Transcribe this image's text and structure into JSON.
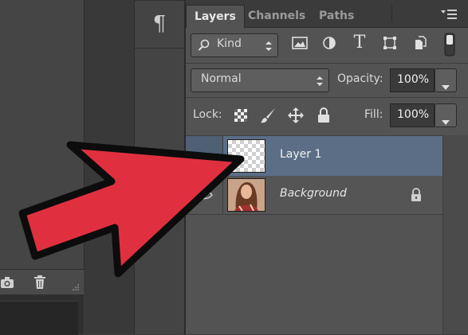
{
  "panel": {
    "tabs": [
      {
        "label": "Layers",
        "active": true
      },
      {
        "label": "Channels",
        "active": false
      },
      {
        "label": "Paths",
        "active": false
      }
    ],
    "filter": {
      "label": "Kind"
    },
    "blend_mode": "Normal",
    "opacity_label": "Opacity:",
    "opacity_value": "100%",
    "lock_label": "Lock:",
    "fill_label": "Fill:",
    "fill_value": "100%"
  },
  "layers": [
    {
      "name": "Layer 1",
      "selected": true
    },
    {
      "name": "Background",
      "italic": true,
      "locked": true
    }
  ],
  "left_toolbar": {
    "paragraph_icon": "¶"
  },
  "colors": {
    "selected_row": "#5b6e86",
    "arrow_red": "#e0303f",
    "panel_bg": "#535353"
  },
  "icons": [
    "search-icon",
    "image-filter-icon",
    "adjustment-filter-icon",
    "type-filter-icon",
    "shape-filter-icon",
    "smart-object-filter-icon",
    "toggle-filter-icon",
    "lock-transparent-icon",
    "lock-paint-brush-icon",
    "lock-position-icon",
    "lock-all-icon",
    "camera-icon",
    "trash-icon",
    "panel-menu-icon"
  ]
}
